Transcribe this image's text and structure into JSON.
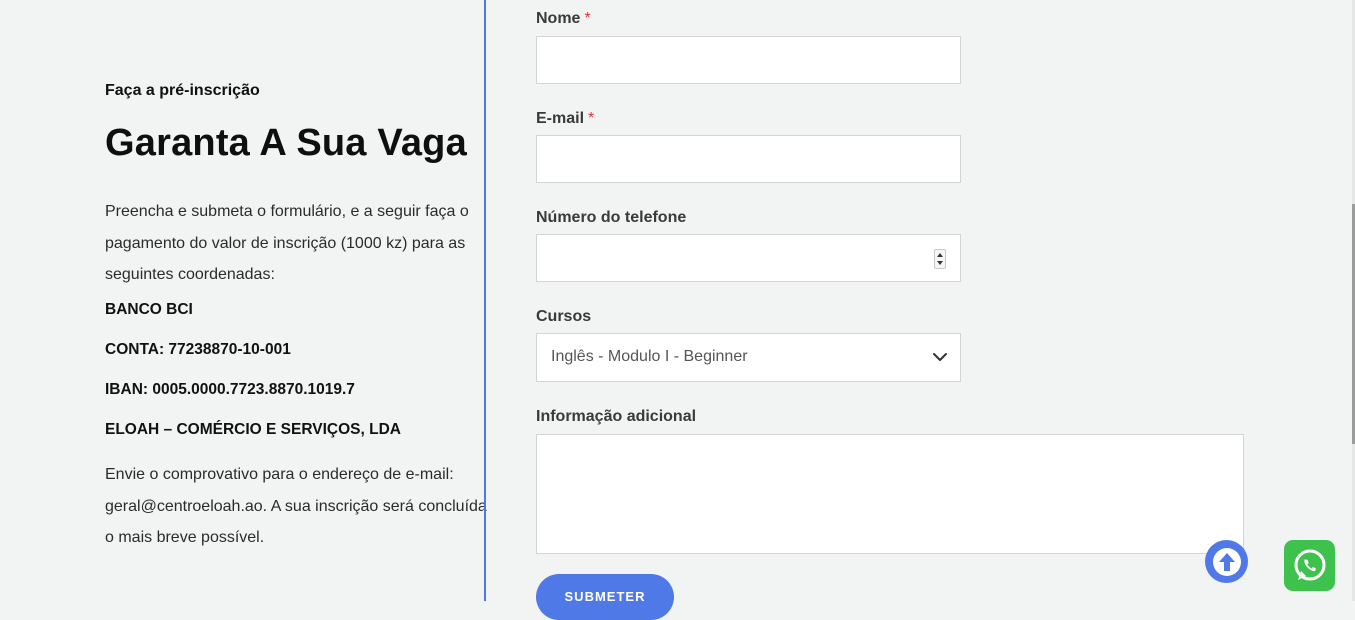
{
  "left": {
    "eyebrow": "Faça a pré-inscrição",
    "headline": "Garanta A Sua Vaga",
    "intro": "Preencha e submeta o formulário, e a seguir faça o pagamento do valor de inscrição (1000 kz) para as seguintes coordenadas:",
    "bank": "BANCO BCI",
    "account": "CONTA: 77238870-10-001",
    "iban": "IBAN: 0005.0000.7723.8870.1019.7",
    "company": "ELOAH – COMÉRCIO E SERVIÇOS, LDA",
    "outro": "Envie o comprovativo para o endereço de e-mail: geral@centroeloah.ao. A sua inscrição será concluída o mais breve possível."
  },
  "form": {
    "name_label": "Nome",
    "email_label": "E-mail",
    "required_mark": "*",
    "phone_label": "Número do telefone",
    "courses_label": "Cursos",
    "courses_selected": "Inglês - Modulo I - Beginner",
    "info_label": "Informação adicional",
    "name_value": "",
    "email_value": "",
    "phone_value": "",
    "info_value": "",
    "submit_label": "SUBMETER"
  },
  "colors": {
    "accent": "#4f79e6",
    "whatsapp": "#3fc24d",
    "required": "#e0332f",
    "background": "#f2f3f3"
  },
  "icons": {
    "scroll_top": "arrow-up-icon",
    "whatsapp": "whatsapp-icon",
    "select": "chevron-down-icon"
  }
}
